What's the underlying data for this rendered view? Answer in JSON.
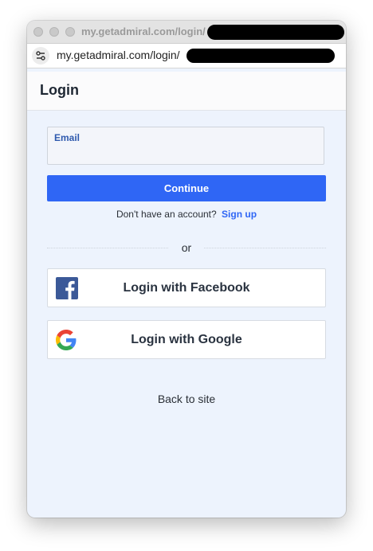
{
  "window": {
    "title": "my.getadmiral.com/login/",
    "url": "my.getadmiral.com/login/"
  },
  "page": {
    "header_title": "Login",
    "email_label": "Email",
    "email_value": "",
    "continue_label": "Continue",
    "no_account_text": "Don't have an account?",
    "signup_label": "Sign up",
    "or_text": "or",
    "facebook_label": "Login with Facebook",
    "google_label": "Login with Google",
    "back_label": "Back to site"
  },
  "colors": {
    "primary": "#2f66f5",
    "background": "#edf3fd",
    "facebook": "#3b5998"
  },
  "icons": {
    "site_settings": "tune-icon",
    "facebook": "facebook-icon",
    "google": "google-icon"
  }
}
